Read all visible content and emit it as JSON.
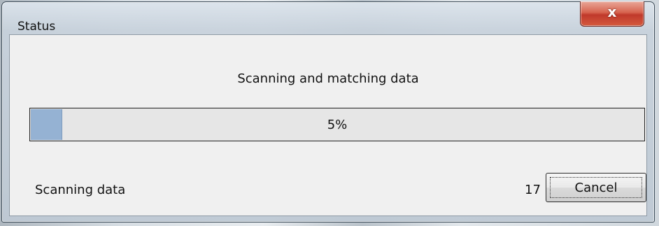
{
  "window": {
    "title": "Status",
    "close_icon": "close-icon",
    "close_glyph": "x"
  },
  "main": {
    "heading": "Scanning and matching data",
    "progress": {
      "percent": 5,
      "label": "5%",
      "fill_color": "#95b2d3"
    },
    "status_text": "Scanning data",
    "count": "17",
    "cancel_label": "Cancel"
  }
}
